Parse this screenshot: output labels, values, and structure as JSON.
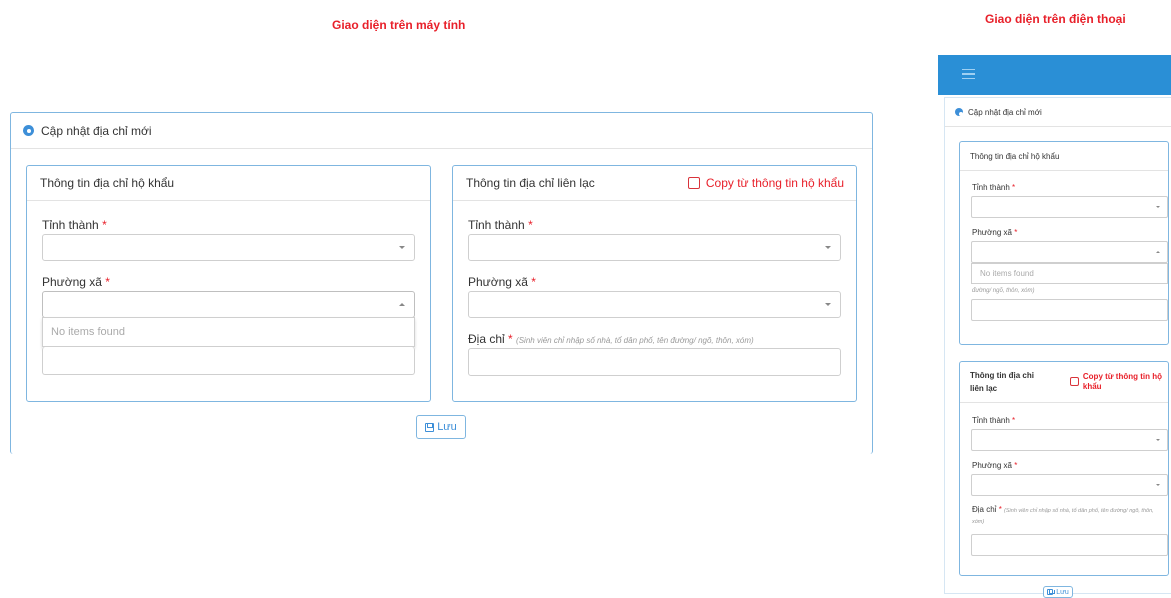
{
  "captions": {
    "desktop": "Giao diện trên máy tính",
    "mobile": "Giao diện trên điện thoại"
  },
  "form": {
    "title": "Cập nhật địa chỉ mới",
    "household_panel": {
      "title": "Thông tin địa chỉ hộ khẩu",
      "province_label": "Tỉnh thành",
      "ward_label": "Phường xã",
      "dropdown_empty": "No items found"
    },
    "contact_panel": {
      "title": "Thông tin địa chỉ liên lạc",
      "copy_label": "Copy từ thông tin hộ khẩu",
      "province_label": "Tỉnh thành",
      "ward_label": "Phường xã",
      "address_label": "Địa chỉ",
      "address_hint": "(Sinh viên chỉ nhập số nhà, tổ dân phố, tên đường/ ngõ, thôn, xóm)"
    },
    "required_mark": "*",
    "save_label": "Lưu"
  },
  "mobile": {
    "household_title": "Thông tin địa chỉ hộ khẩu",
    "contact_title_line1": "Thông tin địa chỉ",
    "contact_title_line2": "liên lạc",
    "copy_label_line1": "Copy từ thông tin hộ",
    "copy_label_line2": "khẩu",
    "address_hint_tail": "đường/ ngõ, thôn, xóm)",
    "address_hint_line1": "(Sinh viên chỉ nhập số nhà, tổ dân phố, tên",
    "address_hint_line2": "đường/ ngõ, thôn, xóm)",
    "save_label": "Lưu"
  },
  "colors": {
    "accent": "#2a8fd6",
    "required": "#e8202a",
    "border": "#7fb6e0"
  },
  "icons": [
    "gear-icon",
    "checkbox-icon",
    "save-icon",
    "menu-icon",
    "chevron-down-icon",
    "chevron-up-icon"
  ]
}
